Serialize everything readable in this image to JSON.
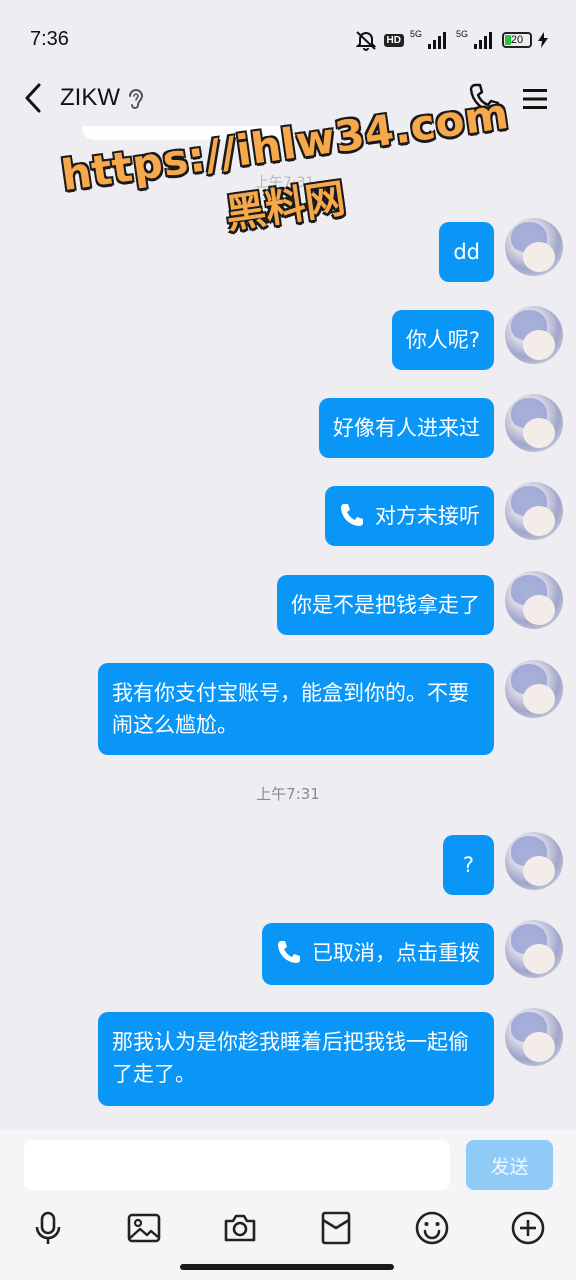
{
  "status_bar": {
    "time": "7:36",
    "hd_label": "HD",
    "signal1": "5G",
    "signal2": "5G",
    "battery": "20"
  },
  "header": {
    "contact_name": "ZIKW"
  },
  "watermark": {
    "url": "https://ihlw34.com",
    "name": "黑料网"
  },
  "messages": [
    {
      "text": "dd"
    },
    {
      "text": "你人呢?"
    },
    {
      "text": "好像有人进来过"
    },
    {
      "text": "对方未接听",
      "icon": "phone-icon"
    },
    {
      "text": "你是不是把钱拿走了"
    },
    {
      "text": "我有你支付宝账号，能盒到你的。不要闹这么尴尬。"
    },
    {
      "text": "?"
    },
    {
      "text": "已取消，点击重拨",
      "icon": "phone-icon"
    },
    {
      "text": "那我认为是你趁我睡着后把我钱一起偷了走了。"
    }
  ],
  "time_separator": "上午7:31",
  "input": {
    "placeholder": "",
    "send_label": "发送"
  },
  "toolbar": [
    "microphone-icon",
    "image-icon",
    "camera-icon",
    "red-packet-icon",
    "emoji-icon",
    "plus-icon"
  ],
  "colors": {
    "bubble": "#0a96f7",
    "background": "#ededf2",
    "send_disabled": "#8fcbf6"
  }
}
